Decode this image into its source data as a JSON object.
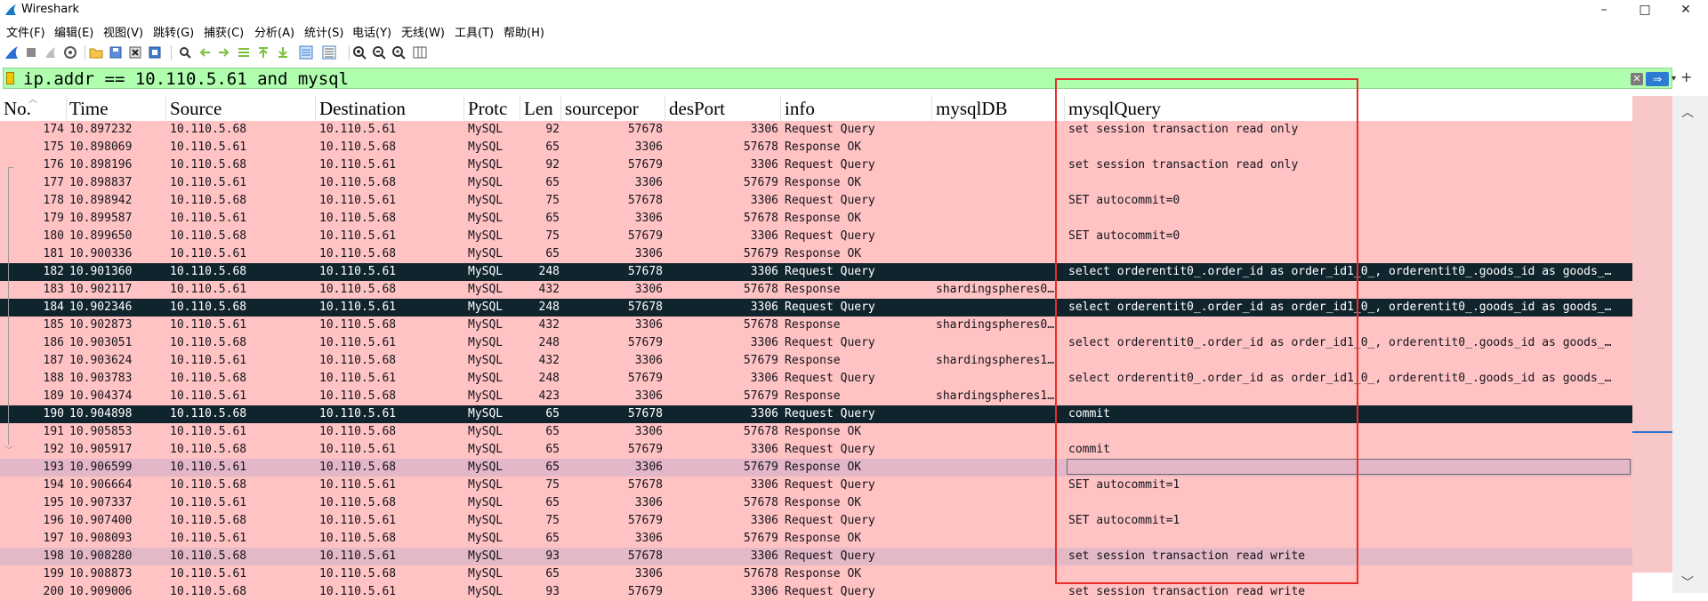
{
  "window": {
    "title": "Wireshark",
    "controls": {
      "minimize": "–",
      "maximize": "□",
      "close": "✕"
    }
  },
  "menu": [
    "文件(F)",
    "编辑(E)",
    "视图(V)",
    "跳转(G)",
    "捕获(C)",
    "分析(A)",
    "统计(S)",
    "电话(Y)",
    "无线(W)",
    "工具(T)",
    "帮助(H)"
  ],
  "toolbar": {
    "icons": [
      "shark-fin-start-icon",
      "stop-capture-icon",
      "restart-capture-icon",
      "capture-options-icon",
      "open-file-icon",
      "save-file-icon",
      "close-file-icon",
      "reload-file-icon",
      "find-packet-icon",
      "go-back-icon",
      "go-forward-icon",
      "go-to-packet-icon",
      "go-first-icon",
      "go-last-icon",
      "auto-scroll-icon",
      "colorize-icon",
      "zoom-in-icon",
      "zoom-out-icon",
      "zoom-normal-icon",
      "resize-columns-icon"
    ]
  },
  "filter": {
    "value": "ip.addr == 10.110.5.61 and mysql",
    "clear_glyph": "✕",
    "apply_glyph": "⇒",
    "dropdown_glyph": "▾",
    "add_glyph": "+",
    "background_color": "#afffaf"
  },
  "columns": [
    "No.",
    "Time",
    "Source",
    "Destination",
    "Protocol",
    "Length",
    "sourceport",
    "desPort",
    "info",
    "mysqlDB",
    "mysqlQuery"
  ],
  "column_headers_display": [
    "No.",
    "Time",
    "Source",
    "Destination",
    "Protc",
    "Len",
    "sourcepor",
    "desPort",
    "info",
    "mysqlDB",
    "mysqlQuery"
  ],
  "colors": {
    "row_default": "#ffc3c3",
    "row_selected": "#10242e",
    "row_selected_text": "#ffffff",
    "row_marked": "#e3b6c8",
    "annotation_box": "#ec2b2b",
    "filter_ok": "#afffaf"
  },
  "packets": [
    {
      "no": "174",
      "time": "10.897232",
      "src": "10.110.5.68",
      "dst": "10.110.5.61",
      "proto": "MySQL",
      "len": "92",
      "sport": "57678",
      "dport": "3306",
      "info": "Request Query",
      "db": "",
      "query": "set session transaction read only",
      "state": ""
    },
    {
      "no": "175",
      "time": "10.898069",
      "src": "10.110.5.61",
      "dst": "10.110.5.68",
      "proto": "MySQL",
      "len": "65",
      "sport": "3306",
      "dport": "57678",
      "info": "Response OK",
      "db": "",
      "query": "",
      "state": ""
    },
    {
      "no": "176",
      "time": "10.898196",
      "src": "10.110.5.68",
      "dst": "10.110.5.61",
      "proto": "MySQL",
      "len": "92",
      "sport": "57679",
      "dport": "3306",
      "info": "Request Query",
      "db": "",
      "query": "set session transaction read only",
      "state": ""
    },
    {
      "no": "177",
      "time": "10.898837",
      "src": "10.110.5.61",
      "dst": "10.110.5.68",
      "proto": "MySQL",
      "len": "65",
      "sport": "3306",
      "dport": "57679",
      "info": "Response OK",
      "db": "",
      "query": "",
      "state": ""
    },
    {
      "no": "178",
      "time": "10.898942",
      "src": "10.110.5.68",
      "dst": "10.110.5.61",
      "proto": "MySQL",
      "len": "75",
      "sport": "57678",
      "dport": "3306",
      "info": "Request Query",
      "db": "",
      "query": "SET autocommit=0",
      "state": ""
    },
    {
      "no": "179",
      "time": "10.899587",
      "src": "10.110.5.61",
      "dst": "10.110.5.68",
      "proto": "MySQL",
      "len": "65",
      "sport": "3306",
      "dport": "57678",
      "info": "Response OK",
      "db": "",
      "query": "",
      "state": ""
    },
    {
      "no": "180",
      "time": "10.899650",
      "src": "10.110.5.68",
      "dst": "10.110.5.61",
      "proto": "MySQL",
      "len": "75",
      "sport": "57679",
      "dport": "3306",
      "info": "Request Query",
      "db": "",
      "query": "SET autocommit=0",
      "state": ""
    },
    {
      "no": "181",
      "time": "10.900336",
      "src": "10.110.5.61",
      "dst": "10.110.5.68",
      "proto": "MySQL",
      "len": "65",
      "sport": "3306",
      "dport": "57679",
      "info": "Response OK",
      "db": "",
      "query": "",
      "state": ""
    },
    {
      "no": "182",
      "time": "10.901360",
      "src": "10.110.5.68",
      "dst": "10.110.5.61",
      "proto": "MySQL",
      "len": "248",
      "sport": "57678",
      "dport": "3306",
      "info": "Request Query",
      "db": "",
      "query": "select orderentit0_.order_id as order_id1_0_, orderentit0_.goods_id as goods_…",
      "state": "sel"
    },
    {
      "no": "183",
      "time": "10.902117",
      "src": "10.110.5.61",
      "dst": "10.110.5.68",
      "proto": "MySQL",
      "len": "432",
      "sport": "3306",
      "dport": "57678",
      "info": "Response",
      "db": "shardingspheres0…",
      "query": "",
      "state": ""
    },
    {
      "no": "184",
      "time": "10.902346",
      "src": "10.110.5.68",
      "dst": "10.110.5.61",
      "proto": "MySQL",
      "len": "248",
      "sport": "57678",
      "dport": "3306",
      "info": "Request Query",
      "db": "",
      "query": "select orderentit0_.order_id as order_id1_0_, orderentit0_.goods_id as goods_…",
      "state": "sel"
    },
    {
      "no": "185",
      "time": "10.902873",
      "src": "10.110.5.61",
      "dst": "10.110.5.68",
      "proto": "MySQL",
      "len": "432",
      "sport": "3306",
      "dport": "57678",
      "info": "Response",
      "db": "shardingspheres0…",
      "query": "",
      "state": ""
    },
    {
      "no": "186",
      "time": "10.903051",
      "src": "10.110.5.68",
      "dst": "10.110.5.61",
      "proto": "MySQL",
      "len": "248",
      "sport": "57679",
      "dport": "3306",
      "info": "Request Query",
      "db": "",
      "query": "select orderentit0_.order_id as order_id1_0_, orderentit0_.goods_id as goods_…",
      "state": ""
    },
    {
      "no": "187",
      "time": "10.903624",
      "src": "10.110.5.61",
      "dst": "10.110.5.68",
      "proto": "MySQL",
      "len": "432",
      "sport": "3306",
      "dport": "57679",
      "info": "Response",
      "db": "shardingspheres1…",
      "query": "",
      "state": ""
    },
    {
      "no": "188",
      "time": "10.903783",
      "src": "10.110.5.68",
      "dst": "10.110.5.61",
      "proto": "MySQL",
      "len": "248",
      "sport": "57679",
      "dport": "3306",
      "info": "Request Query",
      "db": "",
      "query": "select orderentit0_.order_id as order_id1_0_, orderentit0_.goods_id as goods_…",
      "state": ""
    },
    {
      "no": "189",
      "time": "10.904374",
      "src": "10.110.5.61",
      "dst": "10.110.5.68",
      "proto": "MySQL",
      "len": "423",
      "sport": "3306",
      "dport": "57679",
      "info": "Response",
      "db": "shardingspheres1…",
      "query": "",
      "state": ""
    },
    {
      "no": "190",
      "time": "10.904898",
      "src": "10.110.5.68",
      "dst": "10.110.5.61",
      "proto": "MySQL",
      "len": "65",
      "sport": "57678",
      "dport": "3306",
      "info": "Request Query",
      "db": "",
      "query": "commit",
      "state": "sel"
    },
    {
      "no": "191",
      "time": "10.905853",
      "src": "10.110.5.61",
      "dst": "10.110.5.68",
      "proto": "MySQL",
      "len": "65",
      "sport": "3306",
      "dport": "57678",
      "info": "Response OK",
      "db": "",
      "query": "",
      "state": ""
    },
    {
      "no": "192",
      "time": "10.905917",
      "src": "10.110.5.68",
      "dst": "10.110.5.61",
      "proto": "MySQL",
      "len": "65",
      "sport": "57679",
      "dport": "3306",
      "info": "Request Query",
      "db": "",
      "query": "commit",
      "state": ""
    },
    {
      "no": "193",
      "time": "10.906599",
      "src": "10.110.5.61",
      "dst": "10.110.5.68",
      "proto": "MySQL",
      "len": "65",
      "sport": "3306",
      "dport": "57679",
      "info": "Response OK",
      "db": "",
      "query": "",
      "state": "mark"
    },
    {
      "no": "194",
      "time": "10.906664",
      "src": "10.110.5.68",
      "dst": "10.110.5.61",
      "proto": "MySQL",
      "len": "75",
      "sport": "57678",
      "dport": "3306",
      "info": "Request Query",
      "db": "",
      "query": "SET autocommit=1",
      "state": ""
    },
    {
      "no": "195",
      "time": "10.907337",
      "src": "10.110.5.61",
      "dst": "10.110.5.68",
      "proto": "MySQL",
      "len": "65",
      "sport": "3306",
      "dport": "57678",
      "info": "Response OK",
      "db": "",
      "query": "",
      "state": ""
    },
    {
      "no": "196",
      "time": "10.907400",
      "src": "10.110.5.68",
      "dst": "10.110.5.61",
      "proto": "MySQL",
      "len": "75",
      "sport": "57679",
      "dport": "3306",
      "info": "Request Query",
      "db": "",
      "query": "SET autocommit=1",
      "state": ""
    },
    {
      "no": "197",
      "time": "10.908093",
      "src": "10.110.5.61",
      "dst": "10.110.5.68",
      "proto": "MySQL",
      "len": "65",
      "sport": "3306",
      "dport": "57679",
      "info": "Response OK",
      "db": "",
      "query": "",
      "state": ""
    },
    {
      "no": "198",
      "time": "10.908280",
      "src": "10.110.5.68",
      "dst": "10.110.5.61",
      "proto": "MySQL",
      "len": "93",
      "sport": "57678",
      "dport": "3306",
      "info": "Request Query",
      "db": "",
      "query": "set session transaction read write",
      "state": "alt"
    },
    {
      "no": "199",
      "time": "10.908873",
      "src": "10.110.5.61",
      "dst": "10.110.5.68",
      "proto": "MySQL",
      "len": "65",
      "sport": "3306",
      "dport": "57678",
      "info": "Response OK",
      "db": "",
      "query": "",
      "state": ""
    },
    {
      "no": "200",
      "time": "10.909006",
      "src": "10.110.5.68",
      "dst": "10.110.5.61",
      "proto": "MySQL",
      "len": "93",
      "sport": "57679",
      "dport": "3306",
      "info": "Request Query",
      "db": "",
      "query": "set session transaction read write",
      "state": ""
    }
  ],
  "scroll": {
    "up_glyph": "︿",
    "down_glyph": "﹀"
  }
}
